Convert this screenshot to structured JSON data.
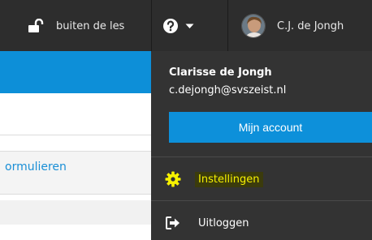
{
  "topbar": {
    "status_label": "buiten de les",
    "user_short": "C.J. de Jongh"
  },
  "page": {
    "link_text": "ormulieren"
  },
  "dropdown": {
    "full_name": "Clarisse de Jongh",
    "email": "c.dejongh@svszeist.nl",
    "account_button": "Mijn account",
    "settings_label": "Instellingen",
    "logout_label": "Uitloggen"
  },
  "colors": {
    "topbar_bg": "#2d2d2d",
    "dropdown_bg": "#333333",
    "accent_blue": "#0d8fd8",
    "highlight_yellow": "#f6f100"
  },
  "icons": [
    "unlock-icon",
    "help-icon",
    "chevron-down-icon",
    "avatar",
    "gear-icon",
    "sign-out-icon"
  ]
}
